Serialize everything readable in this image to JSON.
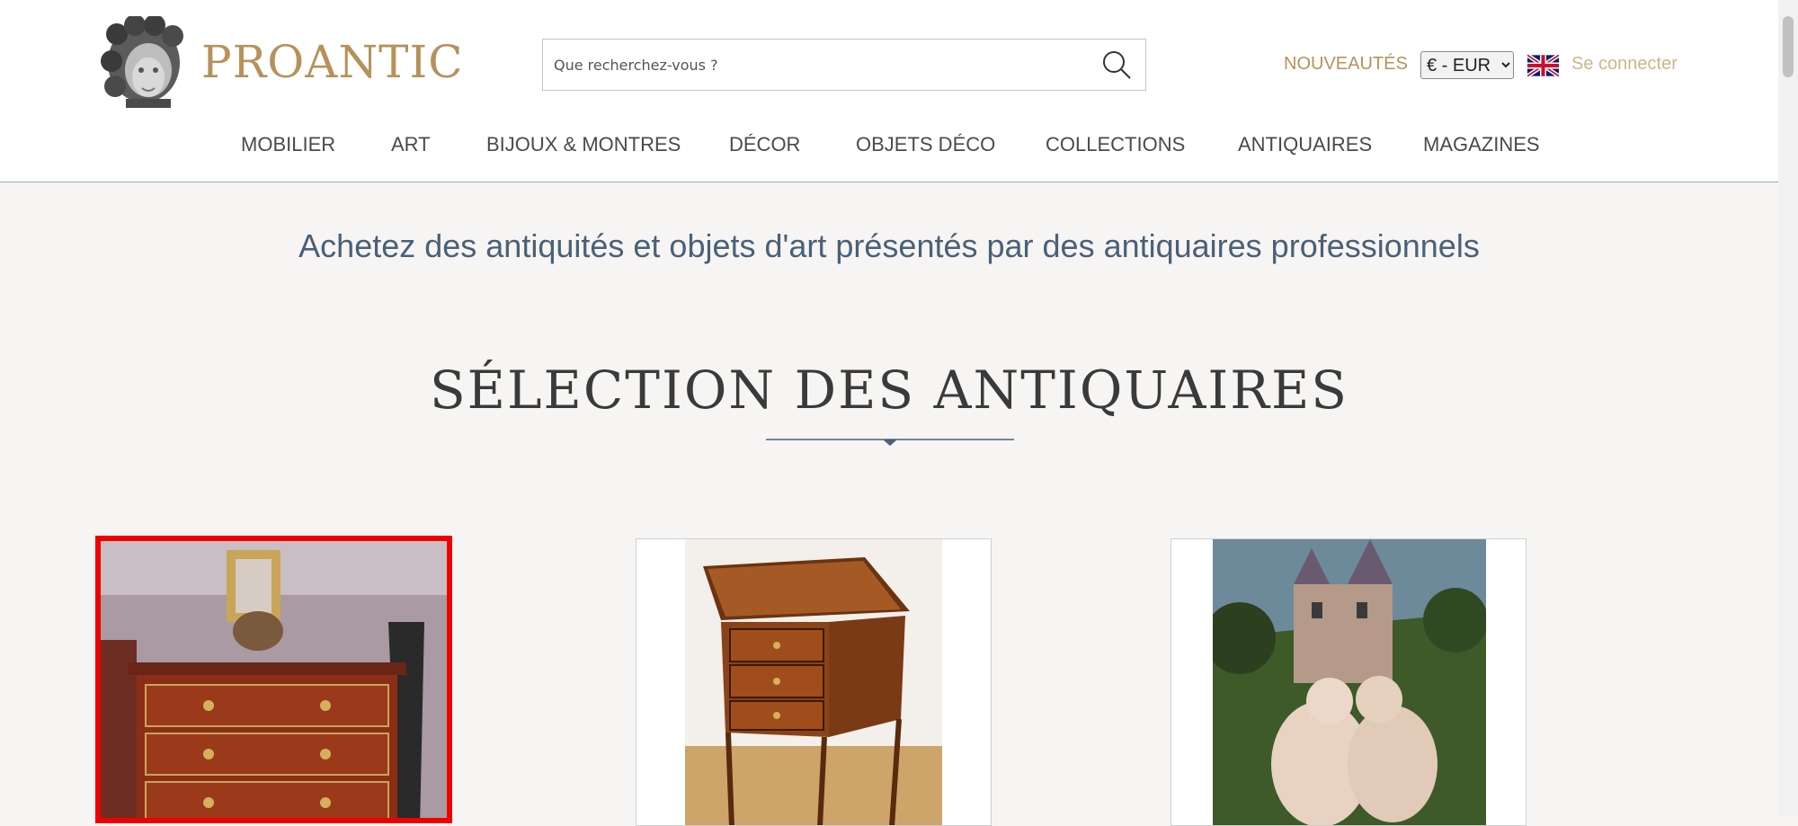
{
  "header": {
    "logo_text": "PROANTIC",
    "search": {
      "placeholder": "Que recherchez-vous ?",
      "value": ""
    },
    "nouveautes": "NOUVEAUTÉS",
    "currency": {
      "selected": "€ - EUR"
    },
    "login": "Se connecter"
  },
  "nav": {
    "items": [
      {
        "label": "MOBILIER"
      },
      {
        "label": "ART"
      },
      {
        "label": "BIJOUX & MONTRES"
      },
      {
        "label": "DÉCOR"
      },
      {
        "label": "OBJETS DÉCO"
      },
      {
        "label": "COLLECTIONS"
      },
      {
        "label": "ANTIQUAIRES"
      },
      {
        "label": "MAGAZINES"
      }
    ]
  },
  "main": {
    "tagline": "Achetez des antiquités et objets d'art présentés par des antiquaires professionnels",
    "section_title": "SÉLECTION DES ANTIQUAIRES"
  },
  "colors": {
    "brand_gold": "#b5925a",
    "nav_text": "#4a4a4a",
    "tagline_blue": "#4a6078",
    "selected_outline": "#ee0000",
    "page_background": "#f6f5f3"
  },
  "icons": {
    "search": "search-icon",
    "flag": "uk-flag-icon",
    "logo": "logo-head-icon"
  }
}
